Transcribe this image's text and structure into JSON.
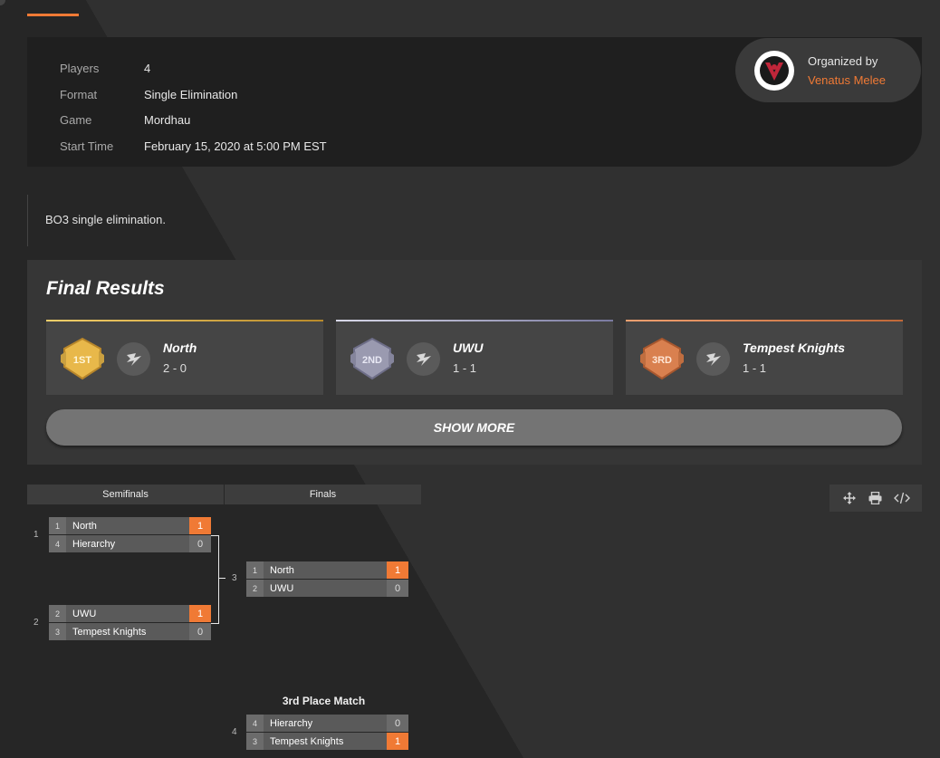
{
  "info": {
    "rows": [
      {
        "label": "Players",
        "value": "4"
      },
      {
        "label": "Format",
        "value": "Single Elimination"
      },
      {
        "label": "Game",
        "value": "Mordhau"
      },
      {
        "label": "Start Time",
        "value": "February 15, 2020 at 5:00 PM EST"
      }
    ]
  },
  "organizer": {
    "label": "Organized by",
    "name": "Venatus Melee"
  },
  "description": "BO3 single elimination.",
  "results": {
    "title": "Final Results",
    "places": [
      {
        "medal": "1ST",
        "team": "North",
        "score": "2 - 0",
        "color": "#e8b84a"
      },
      {
        "medal": "2ND",
        "team": "UWU",
        "score": "1 - 1",
        "color": "#9c9cb8"
      },
      {
        "medal": "3RD",
        "team": "Tempest Knights",
        "score": "1 - 1",
        "color": "#e08a5c"
      }
    ],
    "show_more": "SHOW MORE"
  },
  "bracket": {
    "rounds": [
      "Semifinals",
      "Finals"
    ],
    "matches": [
      {
        "id": "1",
        "slots": [
          {
            "seed": "1",
            "name": "North",
            "score": "1",
            "win": true
          },
          {
            "seed": "4",
            "name": "Hierarchy",
            "score": "0",
            "win": false
          }
        ]
      },
      {
        "id": "2",
        "slots": [
          {
            "seed": "2",
            "name": "UWU",
            "score": "1",
            "win": true
          },
          {
            "seed": "3",
            "name": "Tempest Knights",
            "score": "0",
            "win": false
          }
        ]
      },
      {
        "id": "3",
        "slots": [
          {
            "seed": "1",
            "name": "North",
            "score": "1",
            "win": true
          },
          {
            "seed": "2",
            "name": "UWU",
            "score": "0",
            "win": false
          }
        ]
      },
      {
        "id": "4",
        "slots": [
          {
            "seed": "4",
            "name": "Hierarchy",
            "score": "0",
            "win": false
          },
          {
            "seed": "3",
            "name": "Tempest Knights",
            "score": "1",
            "win": true
          }
        ]
      }
    ],
    "third_place_title": "3rd Place Match"
  },
  "tools": [
    "move-icon",
    "print-icon",
    "embed-code-icon"
  ],
  "colors": {
    "accent": "#f07a35"
  }
}
